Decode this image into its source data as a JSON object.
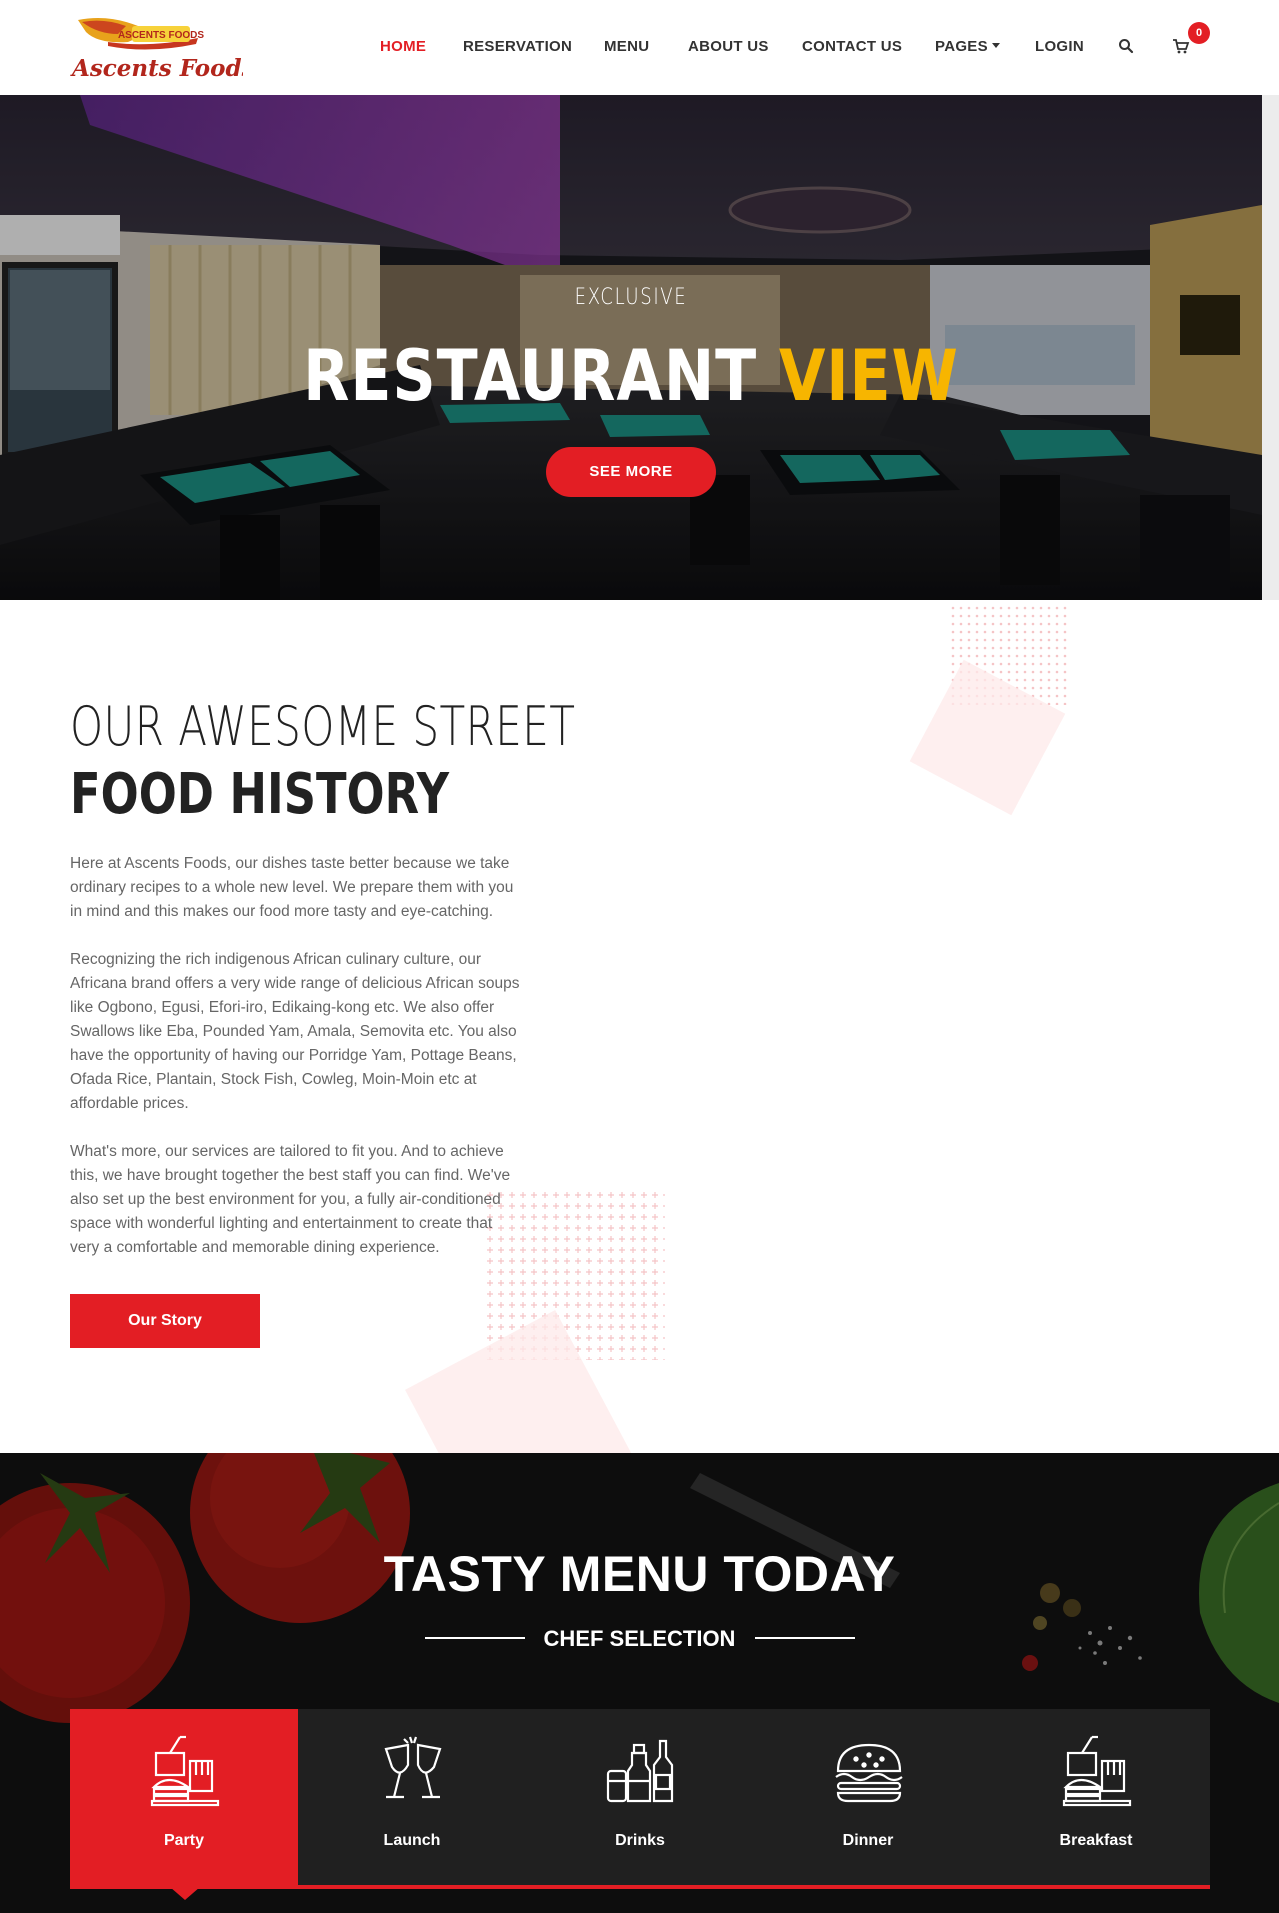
{
  "brand": {
    "badge_text": "ASCENTS FOODS",
    "script_name": "Ascents Foods",
    "colors": {
      "red": "#e31e24",
      "yellow": "#f7b500",
      "orange": "#e8a21b"
    }
  },
  "nav": {
    "home": "HOME",
    "reservation": "RESERVATION",
    "menu": "MENU",
    "about": "ABOUT US",
    "contact": "CONTACT US",
    "pages": "PAGES",
    "login": "LOGIN",
    "search_icon": "search-icon",
    "cart_icon": "cart-icon",
    "cart_count": "0"
  },
  "hero": {
    "eyebrow": "EXCLUSIVE",
    "title_white": "RESTAURANT",
    "title_yellow": "VIEW",
    "button": "SEE MORE"
  },
  "story": {
    "heading_light": "OUR AWESOME STREET",
    "heading_bold": "FOOD HISTORY",
    "paragraphs": [
      "Here at Ascents Foods, our dishes taste better because we take ordinary recipes to a whole new level. We prepare them with you in mind and this makes our food more tasty and eye-catching.",
      "Recognizing the rich indigenous African culinary culture, our Africana brand offers a very wide range of delicious African soups like Ogbono, Egusi, Efori-iro, Edikaing-kong etc. We also offer Swallows like Eba, Pounded Yam, Amala, Semovita etc. You also have the opportunity of having our Porridge Yam, Pottage Beans, Ofada Rice, Plantain, Stock Fish, Cowleg, Moin-Moin etc at affordable prices.",
      "What's more, our services are tailored to fit you. And to achieve this, we have brought together the best staff you can find. We've also set up the best environment for you, a fully air-conditioned space with wonderful lighting and entertainment to create that very a comfortable and memorable dining experience."
    ],
    "button": "Our Story"
  },
  "menu": {
    "title": "TASTY MENU TODAY",
    "subtitle": "CHEF SELECTION",
    "tabs": [
      {
        "label": "Party",
        "icon": "party-combo-icon",
        "active": true
      },
      {
        "label": "Launch",
        "icon": "wine-glasses-icon",
        "active": false
      },
      {
        "label": "Drinks",
        "icon": "drinks-bottles-icon",
        "active": false
      },
      {
        "label": "Dinner",
        "icon": "burger-icon",
        "active": false
      },
      {
        "label": "Breakfast",
        "icon": "breakfast-combo-icon",
        "active": false
      }
    ]
  }
}
